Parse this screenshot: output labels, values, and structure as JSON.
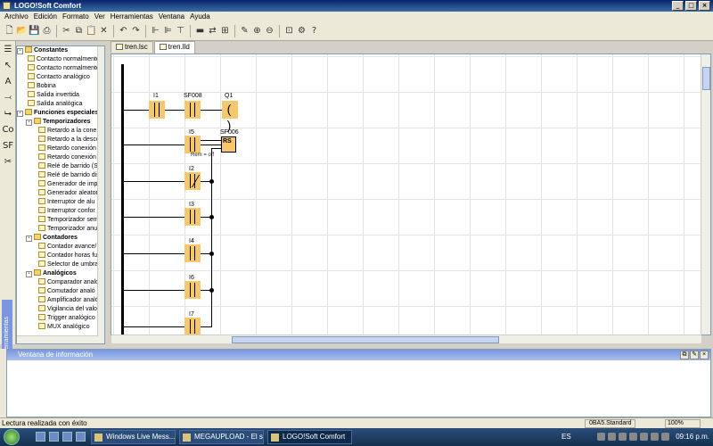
{
  "window": {
    "title": "LOGO!Soft Comfort"
  },
  "menu": [
    "Archivo",
    "Edición",
    "Formato",
    "Ver",
    "Herramientas",
    "Ventana",
    "Ayuda"
  ],
  "vtools_label": "Herramientas",
  "tabs": [
    {
      "label": "tren.lsc"
    },
    {
      "label": "tren.lld"
    }
  ],
  "tree": {
    "constantes": "Constantes",
    "constantes_items": [
      "Contacto normalmente",
      "Contacto normalmente",
      "Contacto analógico",
      "Bobina",
      "Salida invertida",
      "Salida analógica"
    ],
    "funciones": "Funciones especiales",
    "temporizadores": "Temporizadores",
    "temporizadores_items": [
      "Retardo a la cone",
      "Retardo a la desco",
      "Retardo conexión",
      "Retardo conexión",
      "Relé de barrido (S",
      "Relé de barrido dis",
      "Generador de impu",
      "Generador aleator",
      "Interruptor de alu",
      "Interruptor confor",
      "Temporizador sem",
      "Temporizador anu"
    ],
    "contadores": "Contadores",
    "contadores_items": [
      "Contador avance/",
      "Contador horas fu",
      "Selector de umbra"
    ],
    "analogicos": "Analógicos",
    "analogicos_items": [
      "Comparador analó",
      "Comutador analó",
      "Amplificador analó",
      "Vigilancia del valor",
      "Trigger analógico",
      "MUX analógico"
    ]
  },
  "diagram": {
    "row1": {
      "in1": "I1",
      "in2": "SF008",
      "out": "Q1",
      "coil_symbol": "( )"
    },
    "row2": {
      "in1": "I5",
      "out": "SF006",
      "block": "RS",
      "remanence": "Rem = off"
    },
    "rows": [
      "I2",
      "I3",
      "I4",
      "I6",
      "I7"
    ]
  },
  "info_window": {
    "title": "Ventana de información"
  },
  "status": {
    "message": "Lectura realizada con éxito",
    "device": "0BA5.Standard",
    "zoom": "100%"
  },
  "taskbar": {
    "tasks": [
      "Windows Live Mess...",
      "MEGAUPLOAD - El s...",
      "LOGO!Soft Comfort"
    ],
    "lang": "ES",
    "clock": "09:16 p.m."
  }
}
